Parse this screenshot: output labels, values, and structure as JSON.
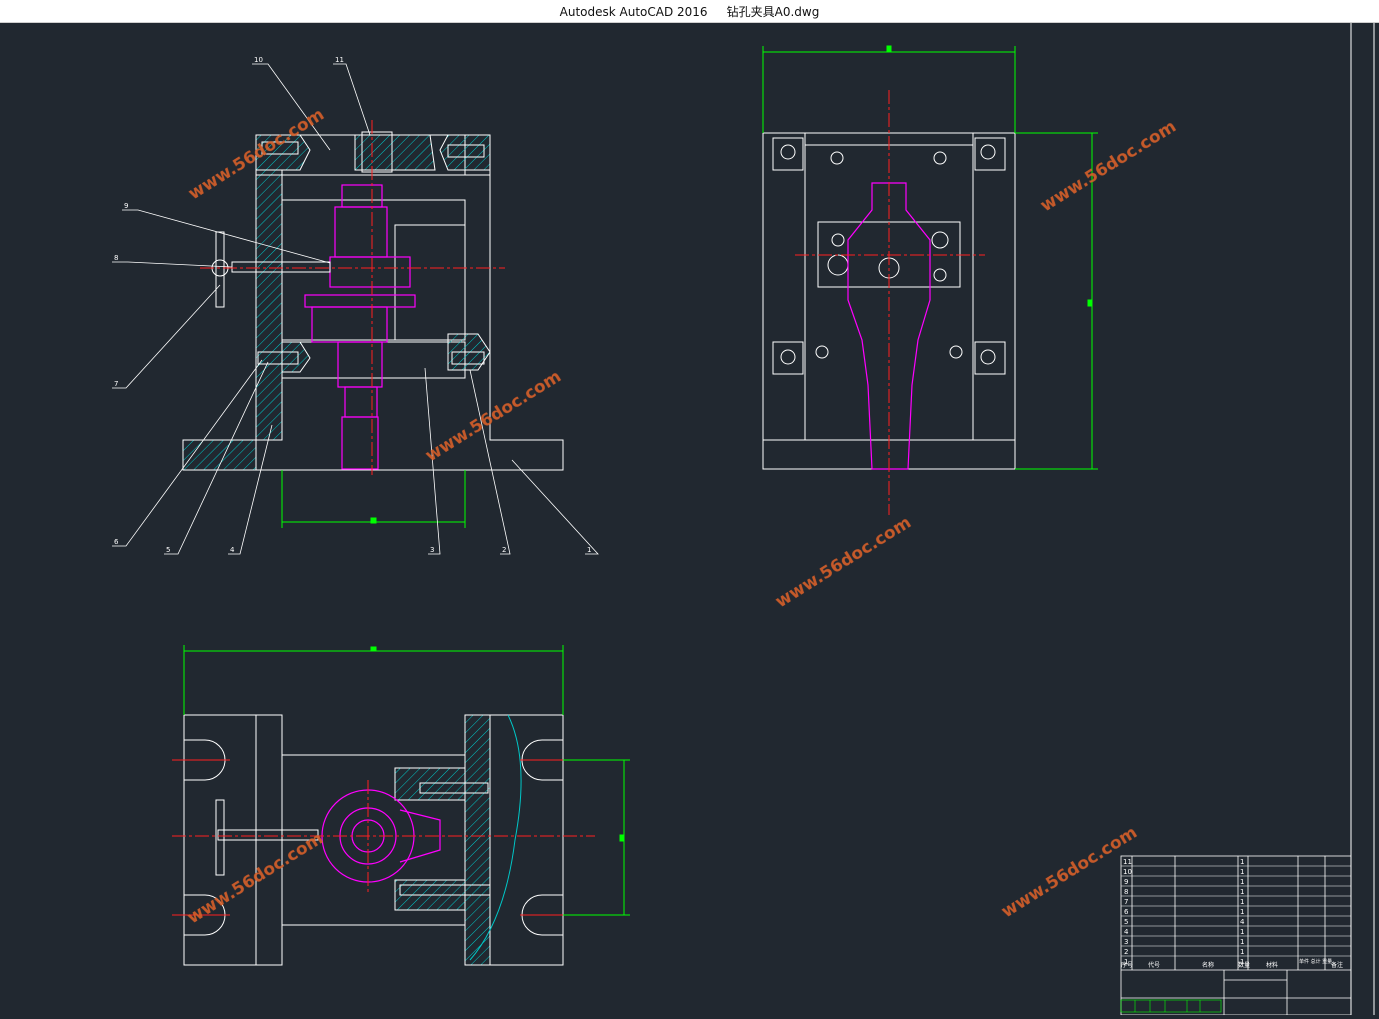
{
  "window": {
    "title": "Autodesk AutoCAD 2016     钻孔夹具A0.dwg"
  },
  "watermark": {
    "text": "www.56doc.com"
  },
  "leaders_front": [
    "10",
    "11",
    "9",
    "8",
    "7",
    "6",
    "5",
    "4",
    "3",
    "2",
    "1"
  ],
  "colors": {
    "background": "#212830",
    "geometry": "#ffffff",
    "dimension": "#00ff00",
    "centerline": "#ff2020",
    "part": "#ff00ff",
    "hatch": "#00c8c8",
    "watermark": "#d8602a"
  },
  "bom": {
    "rows": [
      [
        "11",
        "",
        "",
        "1",
        ""
      ],
      [
        "10",
        "",
        "",
        "1",
        ""
      ],
      [
        "9",
        "",
        "",
        "1",
        ""
      ],
      [
        "8",
        "",
        "",
        "1",
        ""
      ],
      [
        "7",
        "",
        "",
        "1",
        ""
      ],
      [
        "6",
        "",
        "",
        "1",
        ""
      ],
      [
        "5",
        "",
        "",
        "4",
        ""
      ],
      [
        "4",
        "",
        "",
        "1",
        ""
      ],
      [
        "3",
        "",
        "",
        "1",
        ""
      ],
      [
        "2",
        "",
        "",
        "1",
        ""
      ],
      [
        "1",
        "",
        "",
        "1",
        ""
      ]
    ],
    "header": [
      "序号",
      "代号",
      "名称",
      "数量",
      "材料",
      "单件 总计 重量",
      "备注"
    ]
  }
}
